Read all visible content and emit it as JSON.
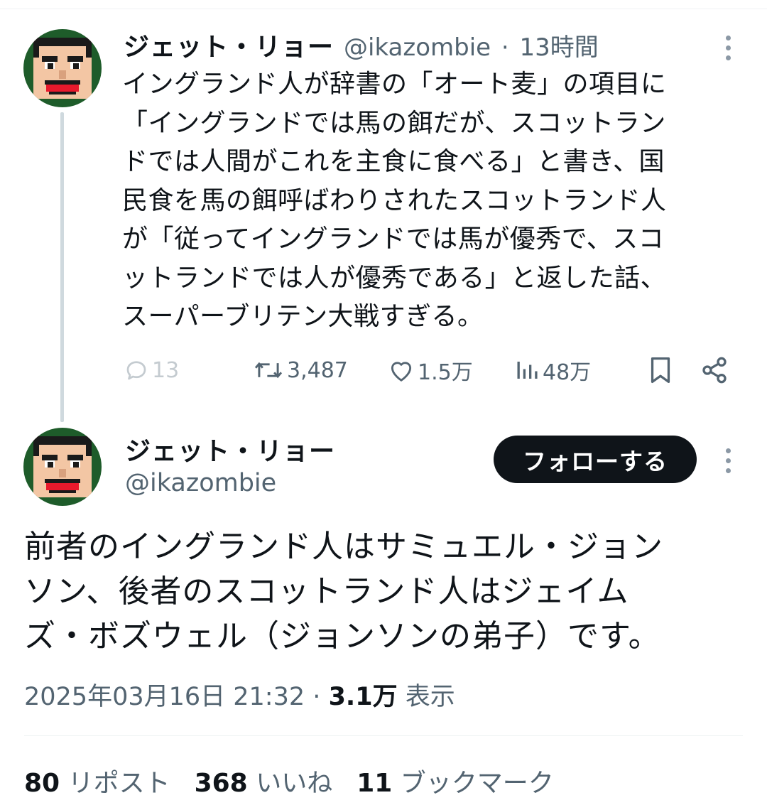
{
  "tweet1": {
    "display_name": "ジェット・リョー",
    "handle": "@ikazombie",
    "separator": "·",
    "time_ago": "13時間",
    "lines": [
      "イングランド人が辞書の「オート麦」の項目に",
      "「イングランドでは馬の餌だが、スコットラン",
      "ドでは人間がこれを主食に食べる」と書き、国",
      "民食を馬の餌呼ばわりされたスコットランド人",
      "が「従ってイングランドでは馬が優秀で、スコ",
      "ットランドでは人が優秀である」と返した話、",
      "スーパーブリテン大戦すぎる。"
    ],
    "actions": {
      "replies": "13",
      "reposts": "3,487",
      "likes": "1.5万",
      "views": "48万"
    }
  },
  "tweet2": {
    "display_name": "ジェット・リョー",
    "handle": "@ikazombie",
    "follow_label": "フォローする",
    "lines": [
      "前者のイングランド人はサミュエル・ジョン",
      "ソン、後者のスコットランド人はジェイム",
      "ズ・ボズウェル（ジョンソンの弟子）です。"
    ],
    "timestamp": "2025年03月16日 21:32",
    "separator": "·",
    "views_count": "3.1万",
    "views_label": "表示",
    "stats": {
      "reposts_count": "80",
      "reposts_label": "リポスト",
      "likes_count": "368",
      "likes_label": "いいね",
      "bookmarks_count": "11",
      "bookmarks_label": "ブックマーク"
    }
  },
  "icons": {
    "reply": "reply-icon",
    "repost": "repost-icon",
    "like": "heart-icon",
    "views": "views-icon",
    "bookmark": "bookmark-icon",
    "share": "share-icon",
    "more": "more-vertical-icon"
  },
  "colors": {
    "text": "#0f1419",
    "secondary": "#536471",
    "avatar_ring": "#1e5c2a",
    "button_bg": "#0f1419",
    "thread_line": "#cfd9de"
  }
}
